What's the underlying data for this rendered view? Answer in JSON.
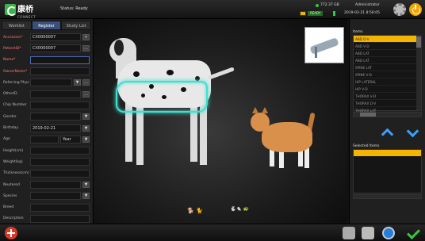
{
  "header": {
    "logo_text": "康桥",
    "logo_sub": "CONNECT",
    "status": "Status: Ready",
    "disk": "772.37 GB",
    "user": "Administrator",
    "ready": "READY",
    "datetime": "2019-02-21 8:56:05"
  },
  "tabs": [
    {
      "label": "Worklist"
    },
    {
      "label": "Register"
    },
    {
      "label": "Study List"
    }
  ],
  "form": {
    "accession_label": "Accession*",
    "accession_value": "CX0000007",
    "patient_id_label": "PatientID*",
    "patient_id_value": "CX0000007",
    "name_label": "Name*",
    "name_value": "",
    "owner_label": "OwnerName*",
    "owner_value": "",
    "ref_phys_label": "Referring Phys",
    "other_id_label": "OtherID",
    "chip_label": "Chip Number",
    "gender_label": "Gender",
    "birthday_label": "Birthday",
    "birthday_value": "2019-02-21",
    "age_label": "Age",
    "age_unit": "Year",
    "height_label": "Height(cm)",
    "weight_label": "Weight(kg)",
    "thickness_label": "Thickness(cm)",
    "neutered_label": "Neutered",
    "species_label": "Species",
    "breed_label": "Breed",
    "description_label": "Description",
    "plus": "+",
    "ellipsis": "…",
    "dropdown": "▼"
  },
  "right": {
    "items_title": "Items",
    "items": [
      {
        "label": "ABD D-V"
      },
      {
        "label": "ABD V-D"
      },
      {
        "label": "ABD LAT"
      },
      {
        "label": "ABD LAT"
      },
      {
        "label": "SPINE LAT"
      },
      {
        "label": "SPINE V-D"
      },
      {
        "label": "HIP LATERAL"
      },
      {
        "label": "HIP V-D"
      },
      {
        "label": "THORAX V-D"
      },
      {
        "label": "THORAX D-V"
      },
      {
        "label": "THORAX LAT"
      }
    ],
    "selected_title": "Selected Items"
  },
  "canvas": {
    "legend_dog": "🐕 🐈",
    "legend_small": "🐇🐁 🐢"
  },
  "colors": {
    "accent_selected": "#f4b400",
    "highlight": "#40e0d0",
    "required_label": "#ff7a7a",
    "arrow": "#3aa0ff"
  }
}
